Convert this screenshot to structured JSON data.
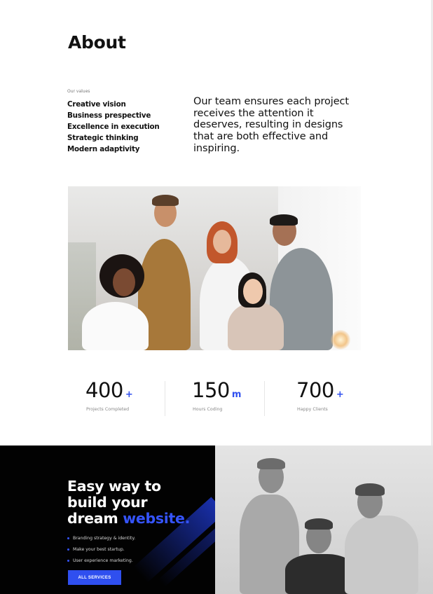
{
  "about": {
    "title": "About",
    "values_caption": "Our values",
    "values": [
      "Creative vision",
      "Business prespective",
      "Excellence in execution",
      "Strategic thinking",
      "Modern adaptivity"
    ],
    "statement": "Our team ensures each project receives the attention it deserves, resulting in designs that are both effective and inspiring."
  },
  "team_photo": {
    "alt": "team-photo"
  },
  "stats": [
    {
      "value": "400",
      "suffix": "+",
      "label": "Projects Completed"
    },
    {
      "value": "150",
      "suffix": "m",
      "label": "Hours Coding"
    },
    {
      "value": "700",
      "suffix": "+",
      "label": "Happy Clients"
    }
  ],
  "hero": {
    "heading_line1": "Easy way to",
    "heading_line2": "build your",
    "heading_line3_prefix": "dream",
    "heading_line3_accent": "website.",
    "bullets": [
      "Branding strategy & identity.",
      "Make your best startup.",
      "User experience marketing."
    ],
    "button_label": "ALL SERVICES"
  },
  "colors": {
    "accent": "#2f4fef",
    "dark_background": "#020202",
    "text": "#111111"
  }
}
